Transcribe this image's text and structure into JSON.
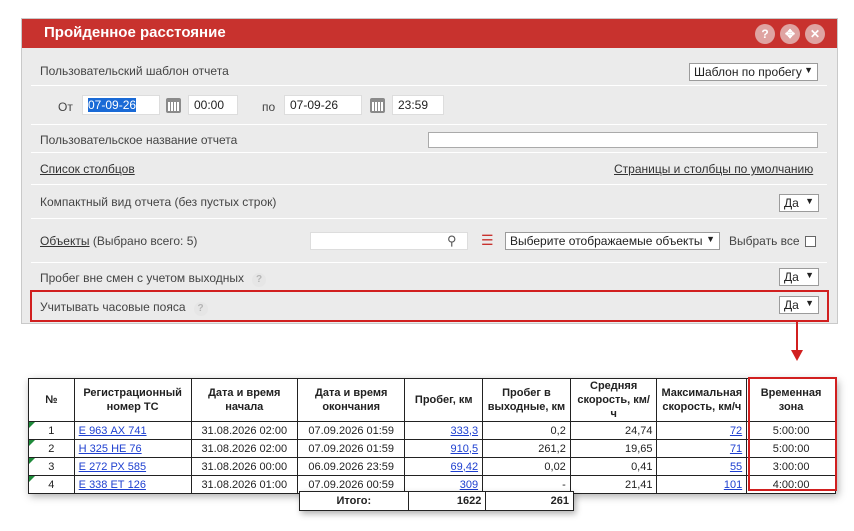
{
  "dialog": {
    "title": "Пройденное расстояние",
    "help_icon": "question-icon",
    "expand_icon": "expand-icon",
    "close_icon": "close-icon",
    "template_label": "Пользовательский шаблон отчета",
    "template_value": "Шаблон по пробегу",
    "from_label": "От",
    "from_date": "07-09-26",
    "from_time": "00:00",
    "to_label": "по",
    "to_date": "07-09-26",
    "to_time": "23:59",
    "name_label": "Пользовательское название отчета",
    "name_value": "",
    "columns_link": "Список столбцов",
    "defaults_link": "Страницы и столбцы по умолчанию",
    "compact_label": "Компактный вид отчета (без пустых строк)",
    "compact_value": "Да",
    "objects_link": "Объекты",
    "objects_selected": "(Выбрано всего: 5)",
    "objects_select": "Выберите отображаемые объекты",
    "select_all_label": "Выбрать все",
    "offshift_label": "Пробег вне смен с учетом выходных",
    "offshift_value": "Да",
    "timezones_label": "Учитывать часовые пояса",
    "timezones_value": "Да",
    "accent_color": "#c8322e",
    "highlight_color": "#d11f1f"
  },
  "report": {
    "headers": [
      "№",
      "Регистрационный номер ТС",
      "Дата и время начала",
      "Дата и время окончания",
      "Пробег, км",
      "Пробег в выходные, км",
      "Средняя скорость, км/ч",
      "Максимальная скорость, км/ч",
      "Временная зона"
    ],
    "rows": [
      {
        "n": "1",
        "plate": "Е 963 АХ 741",
        "start": "31.08.2026 02:00",
        "end": "07.09.2026 01:59",
        "mileage": "333,3",
        "weekend": "0,2",
        "avg": "24,74",
        "max": "72",
        "tz": "5:00:00"
      },
      {
        "n": "2",
        "plate": "Н 325 НЕ 76",
        "start": "31.08.2026 02:00",
        "end": "07.09.2026 01:59",
        "mileage": "910,5",
        "weekend": "261,2",
        "avg": "19,65",
        "max": "71",
        "tz": "5:00:00"
      },
      {
        "n": "3",
        "plate": "Е 272 РХ 585",
        "start": "31.08.2026 00:00",
        "end": "06.09.2026 23:59",
        "mileage": "69,42",
        "weekend": "0,02",
        "avg": "0,41",
        "max": "55",
        "tz": "3:00:00"
      },
      {
        "n": "4",
        "plate": "Е 338 ЕТ 126",
        "start": "31.08.2026 01:00",
        "end": "07.09.2026 00:59",
        "mileage": "309",
        "weekend": "-",
        "avg": "21,41",
        "max": "101",
        "tz": "4:00:00"
      }
    ],
    "totals": {
      "label": "Итого:",
      "mileage": "1622",
      "weekend": "261"
    }
  }
}
